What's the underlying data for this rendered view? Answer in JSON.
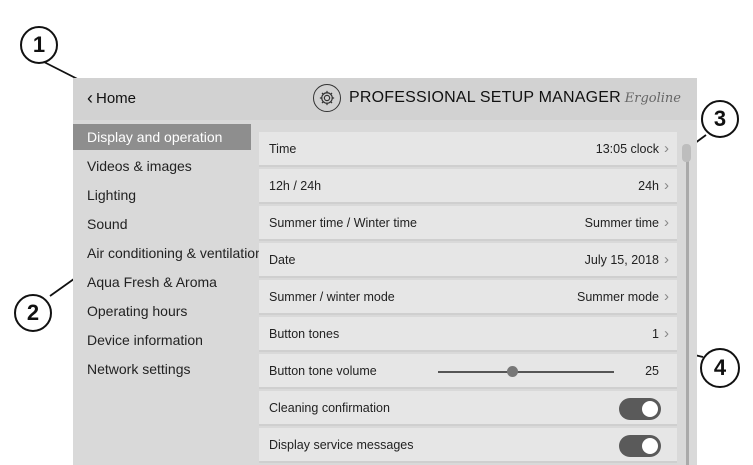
{
  "header": {
    "home_label": "Home",
    "title": "PROFESSIONAL SETUP MANAGER",
    "brand": "Ergoline"
  },
  "sidebar": {
    "items": [
      {
        "label": "Display and operation",
        "active": true
      },
      {
        "label": "Videos & images"
      },
      {
        "label": "Lighting"
      },
      {
        "label": "Sound"
      },
      {
        "label": "Air conditioning & ventilation"
      },
      {
        "label": "Aqua Fresh & Aroma"
      },
      {
        "label": "Operating hours"
      },
      {
        "label": "Device information"
      },
      {
        "label": "Network settings"
      }
    ]
  },
  "settings": {
    "rows": [
      {
        "label": "Time",
        "value": "13:05 clock"
      },
      {
        "label": "12h / 24h",
        "value": "24h"
      },
      {
        "label": "Summer time / Winter time",
        "value": "Summer time"
      },
      {
        "label": "Date",
        "value": "July 15, 2018"
      },
      {
        "label": "Summer / winter mode",
        "value": "Summer mode"
      },
      {
        "label": "Button tones",
        "value": "1"
      },
      {
        "label": "Button tone volume",
        "value": "25",
        "slider_fraction": 0.42
      },
      {
        "label": "Cleaning confirmation",
        "toggle": "on"
      },
      {
        "label": "Display service messages",
        "toggle": "on"
      }
    ]
  },
  "callouts": [
    "1",
    "2",
    "3",
    "4"
  ],
  "icons": {
    "home": "chevron-left-icon",
    "title": "gear-icon",
    "row": "chevron-right-icon"
  }
}
